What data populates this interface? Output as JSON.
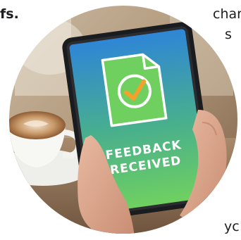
{
  "text_fragments": {
    "left_bold": "fs.",
    "right_top": "char",
    "right_second": "s",
    "right_bottom": "yc"
  },
  "tablet_screen": {
    "line1": "FEEDBACK",
    "line2": "RECEIVED",
    "icon": "checkmark-document-icon"
  },
  "colors": {
    "screen_gradient_top": "#2f86d6",
    "screen_gradient_bottom": "#6fd060",
    "check_orange": "#f3a12a",
    "tablet_bezel": "#1a1c1f"
  }
}
